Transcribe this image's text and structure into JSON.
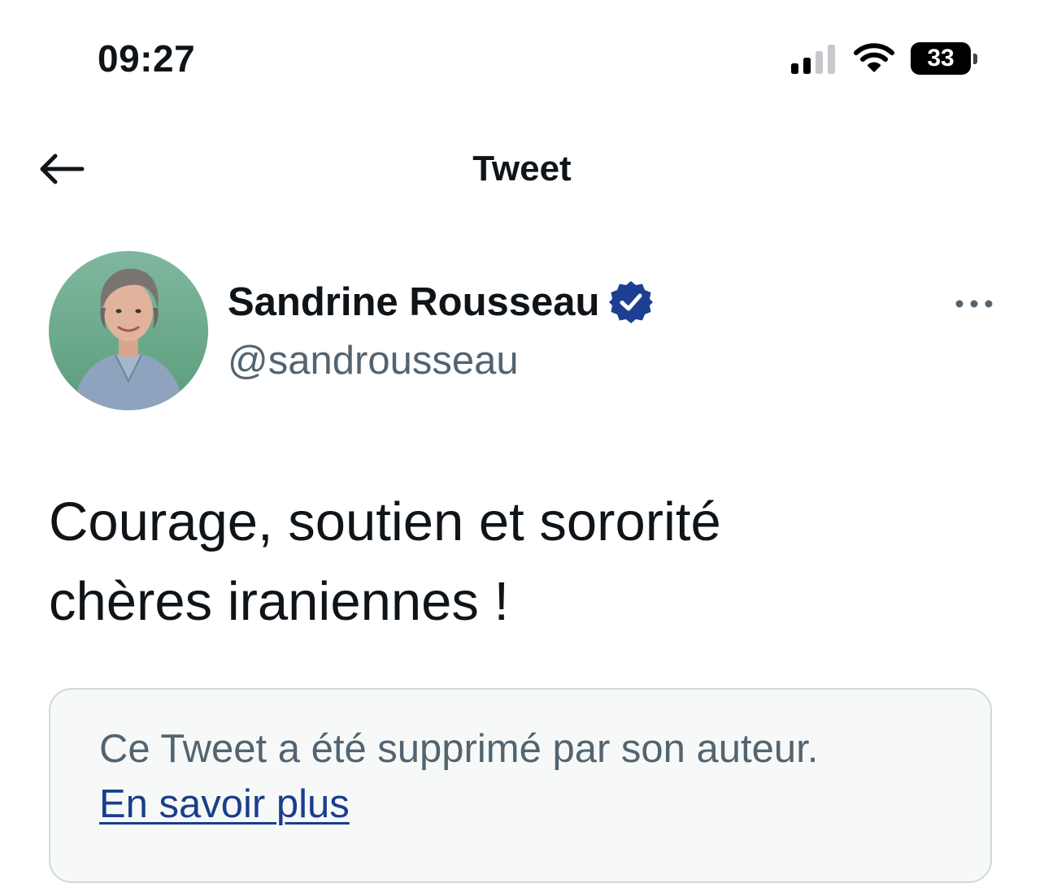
{
  "status_bar": {
    "time": "09:27",
    "battery": "33",
    "icons": [
      "signal-icon",
      "wifi-icon",
      "battery-icon"
    ]
  },
  "header": {
    "title": "Tweet",
    "back_icon": "back-arrow-icon"
  },
  "tweet": {
    "author_name": "Sandrine Rousseau",
    "handle": "@sandrousseau",
    "verified": true,
    "text_line1": "Courage, soutien et sororité",
    "text_line2": "chères iraniennes !",
    "more_icon": "more-options-icon"
  },
  "deleted_quote": {
    "message": "Ce Tweet a été supprimé par son auteur.",
    "link_label": "En savoir plus"
  },
  "colors": {
    "text_primary": "#0f1419",
    "text_secondary": "#536471",
    "link": "#1a3e8c",
    "verified_badge": "#1d3f91",
    "box_border": "#cfd9de",
    "box_background": "#f7f9f9"
  }
}
